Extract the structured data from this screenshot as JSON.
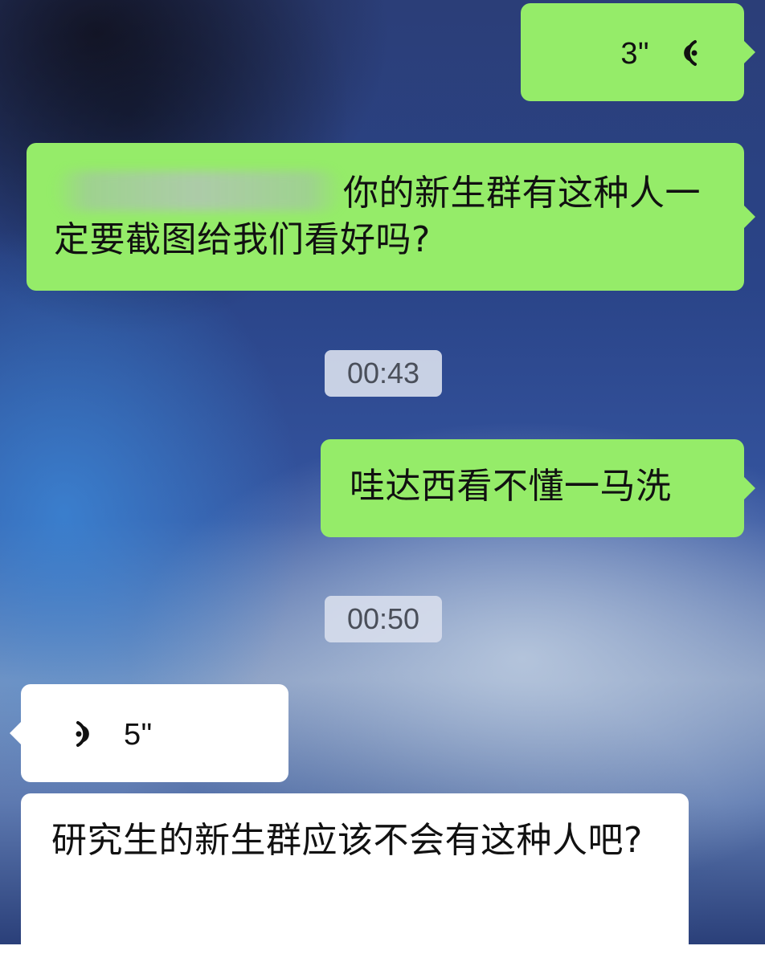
{
  "chat": {
    "messages": [
      {
        "sender": "self",
        "type": "voice",
        "duration": "3\"",
        "icon": "voice-wave-icon"
      },
      {
        "sender": "self",
        "type": "text",
        "text": "你的新生群有这种人一定要截图给我们看好吗?"
      },
      {
        "type": "timestamp",
        "text": "00:43"
      },
      {
        "sender": "self",
        "type": "text",
        "text": "哇达西看不懂一马洗"
      },
      {
        "type": "timestamp",
        "text": "00:50"
      },
      {
        "sender": "other",
        "type": "voice",
        "duration": "5\"",
        "icon": "voice-wave-icon"
      },
      {
        "sender": "other",
        "type": "text",
        "text": "研究生的新生群应该不会有这种人吧?"
      }
    ]
  },
  "colors": {
    "self_bubble": "#95EC69",
    "other_bubble": "#FFFFFF",
    "timestamp_pill": "#D6DCEC"
  }
}
